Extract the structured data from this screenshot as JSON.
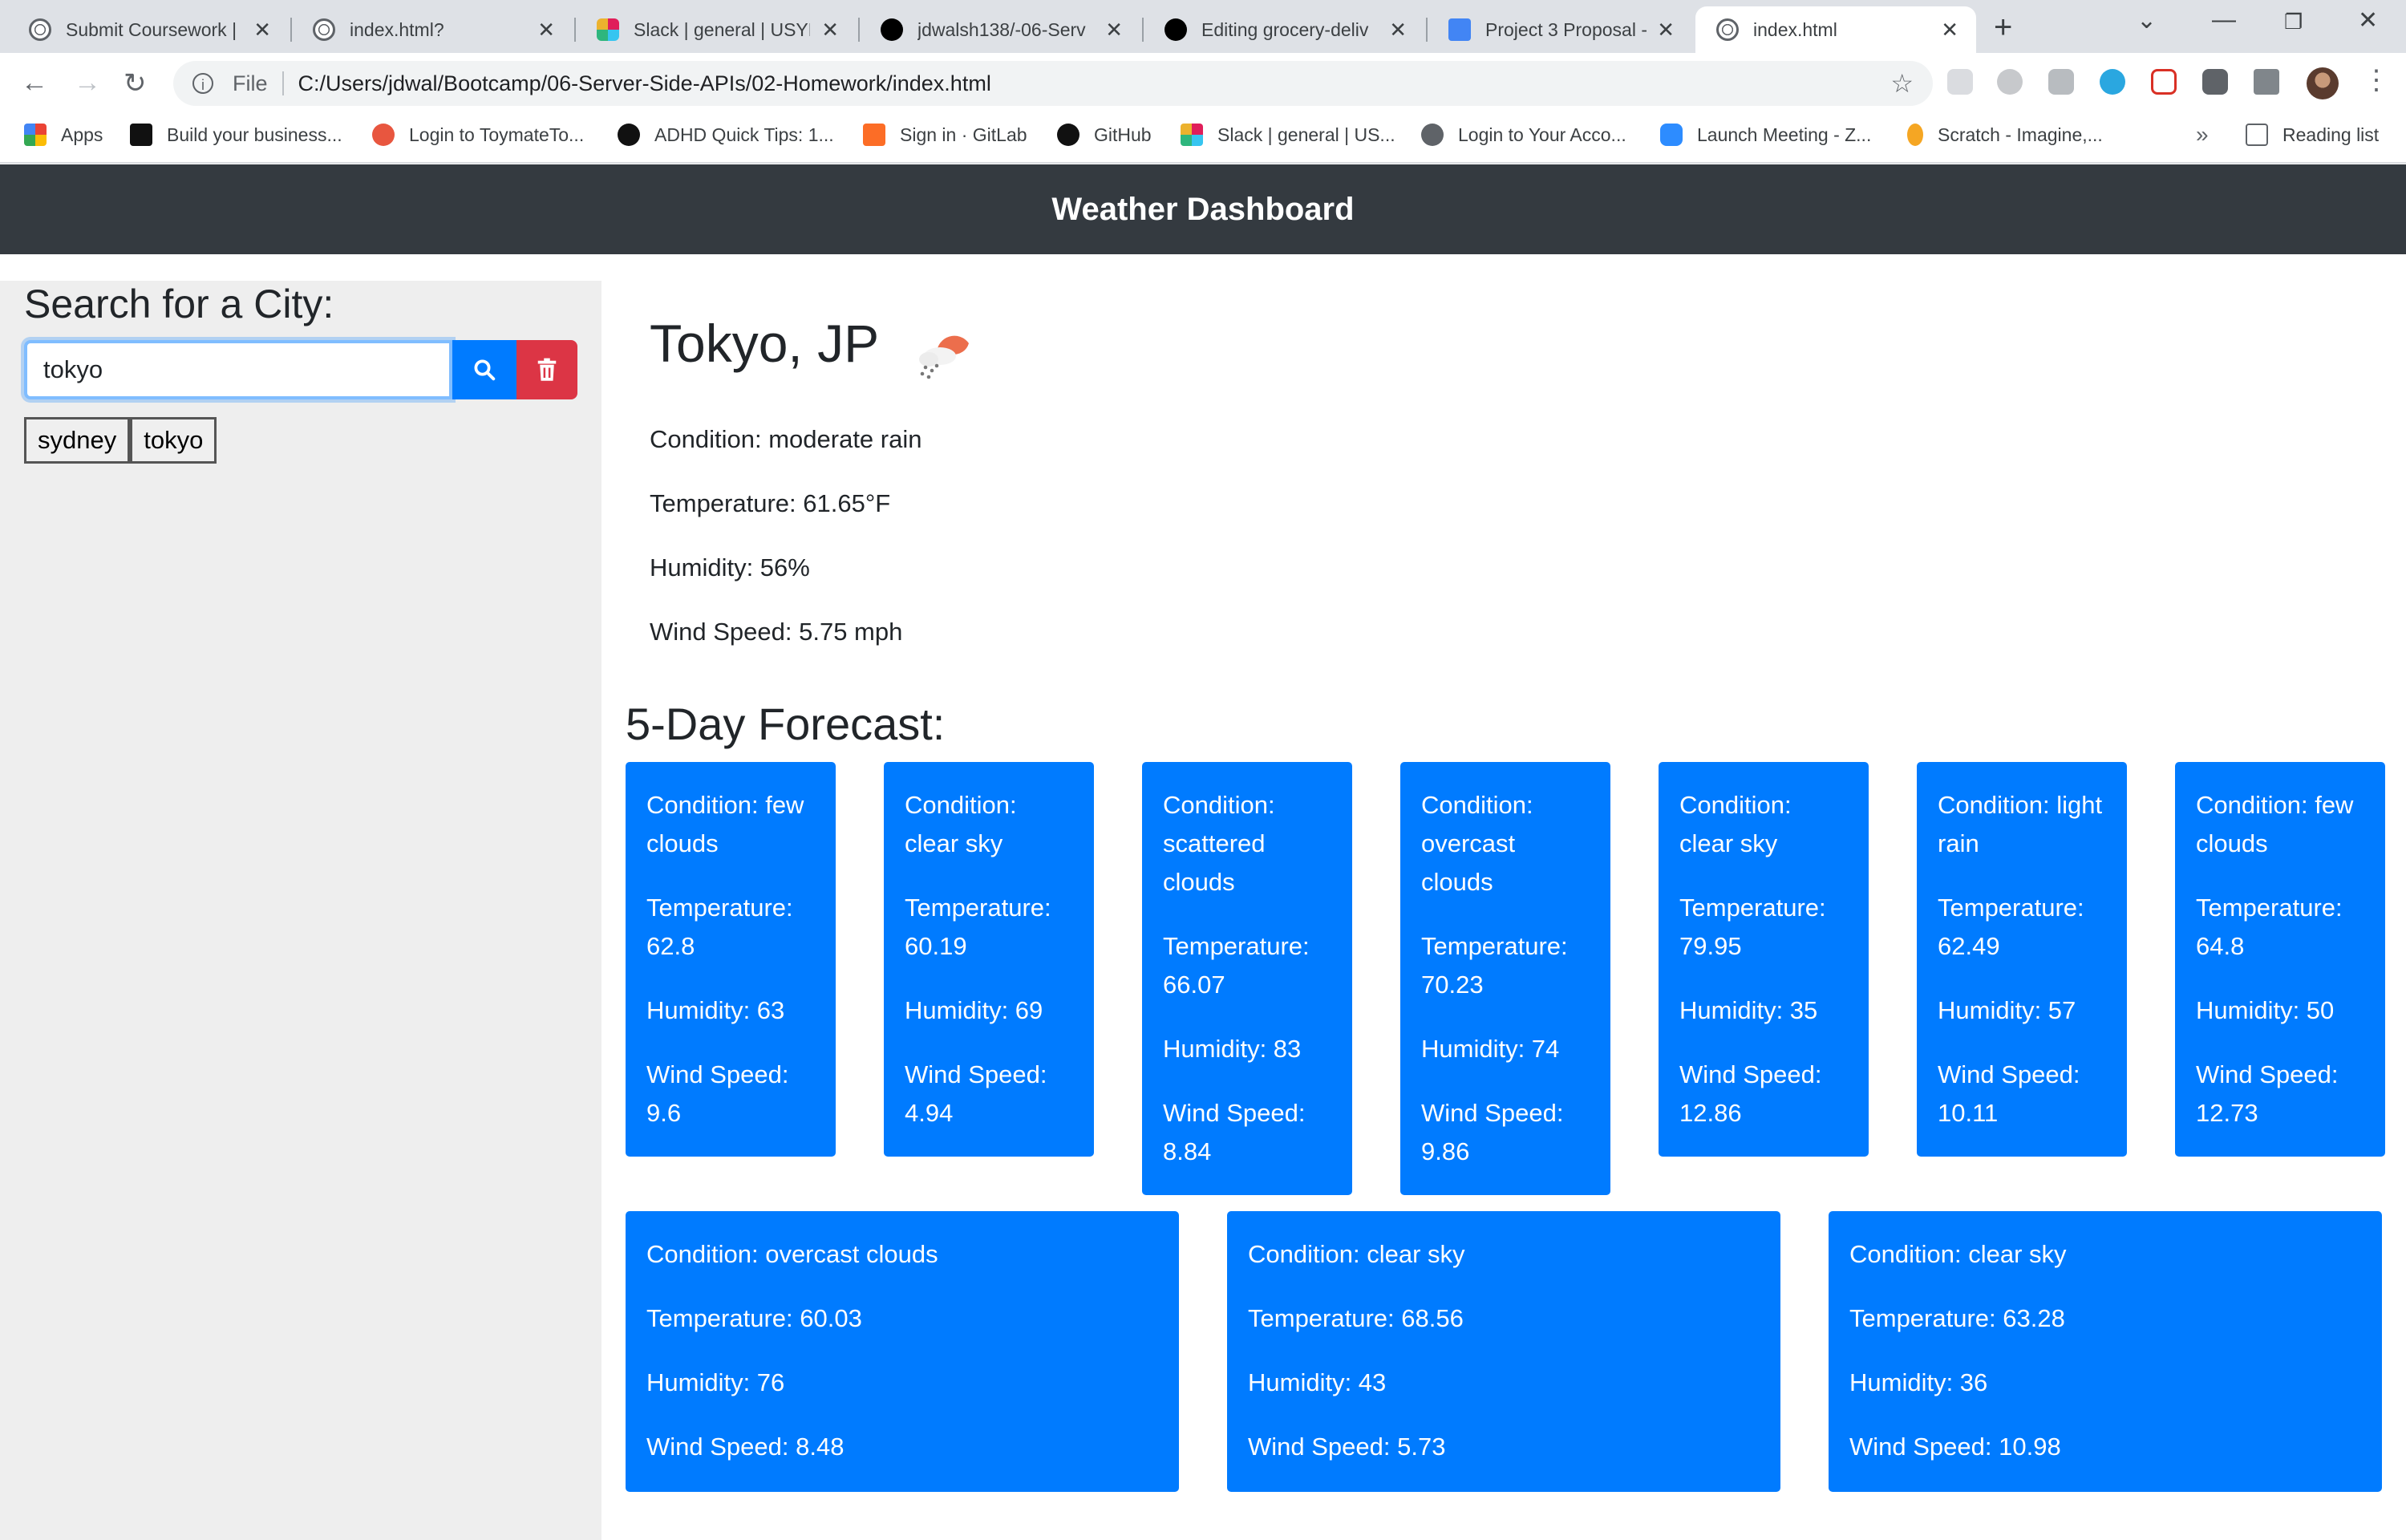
{
  "browser": {
    "tabs": [
      {
        "title": "Submit Coursework |",
        "icon": "globe-icon"
      },
      {
        "title": "index.html?",
        "icon": "globe-icon"
      },
      {
        "title": "Slack | general | USYD",
        "icon": "slack-icon"
      },
      {
        "title": "jdwalsh138/-06-Serv",
        "icon": "github-icon"
      },
      {
        "title": "Editing grocery-deliv",
        "icon": "github-icon"
      },
      {
        "title": "Project 3 Proposal -",
        "icon": "docs-icon"
      },
      {
        "title": "index.html",
        "icon": "globe-icon"
      }
    ],
    "active_tab": 6,
    "address": {
      "scheme_label": "File",
      "url": "C:/Users/jdwal/Bootcamp/06-Server-Side-APIs/02-Homework/index.html"
    },
    "bookmarks": [
      {
        "label": "Apps"
      },
      {
        "label": "Build your business..."
      },
      {
        "label": "Login to ToymateTo..."
      },
      {
        "label": "ADHD Quick Tips: 1..."
      },
      {
        "label": "Sign in · GitLab"
      },
      {
        "label": "GitHub"
      },
      {
        "label": "Slack | general | US..."
      },
      {
        "label": "Login to Your Acco..."
      },
      {
        "label": "Launch Meeting - Z..."
      },
      {
        "label": "Scratch - Imagine,..."
      }
    ],
    "reading_list": "Reading list"
  },
  "header": {
    "title": "Weather Dashboard"
  },
  "sidebar": {
    "search_title": "Search for a City:",
    "search_value": "tokyo",
    "history": [
      "sydney",
      "tokyo"
    ]
  },
  "current": {
    "city": "Tokyo, JP",
    "icon": "rain-cloud-icon",
    "condition": "Condition: moderate rain",
    "temperature": "Temperature: 61.65°F",
    "humidity": "Humidity: 56%",
    "wind": "Wind Speed: 5.75 mph"
  },
  "forecast": {
    "title": "5-Day Forecast:",
    "cards": [
      {
        "condition": "Condition: few clouds",
        "temperature": "Temperature: 62.8",
        "humidity": "Humidity: 63",
        "wind": "Wind Speed: 9.6"
      },
      {
        "condition": "Condition: clear sky",
        "temperature": "Temperature: 60.19",
        "humidity": "Humidity: 69",
        "wind": "Wind Speed: 4.94"
      },
      {
        "condition": "Condition: scattered clouds",
        "temperature": "Temperature: 66.07",
        "humidity": "Humidity: 83",
        "wind": "Wind Speed: 8.84"
      },
      {
        "condition": "Condition: overcast clouds",
        "temperature": "Temperature: 70.23",
        "humidity": "Humidity: 74",
        "wind": "Wind Speed: 9.86"
      },
      {
        "condition": "Condition: clear sky",
        "temperature": "Temperature: 79.95",
        "humidity": "Humidity: 35",
        "wind": "Wind Speed: 12.86"
      },
      {
        "condition": "Condition: light rain",
        "temperature": "Temperature: 62.49",
        "humidity": "Humidity: 57",
        "wind": "Wind Speed: 10.11"
      },
      {
        "condition": "Condition: few clouds",
        "temperature": "Temperature: 64.8",
        "humidity": "Humidity: 50",
        "wind": "Wind Speed: 12.73"
      },
      {
        "condition": "Condition: overcast clouds",
        "temperature": "Temperature: 60.03",
        "humidity": "Humidity: 76",
        "wind": "Wind Speed: 8.48"
      },
      {
        "condition": "Condition: clear sky",
        "temperature": "Temperature: 68.56",
        "humidity": "Humidity: 43",
        "wind": "Wind Speed: 5.73"
      },
      {
        "condition": "Condition: clear sky",
        "temperature": "Temperature: 63.28",
        "humidity": "Humidity: 36",
        "wind": "Wind Speed: 10.98"
      }
    ]
  },
  "colors": {
    "header_bg": "#343a40",
    "card_bg": "#007bff",
    "delete_bg": "#dc3545",
    "sidebar_bg": "#eeeeee"
  }
}
